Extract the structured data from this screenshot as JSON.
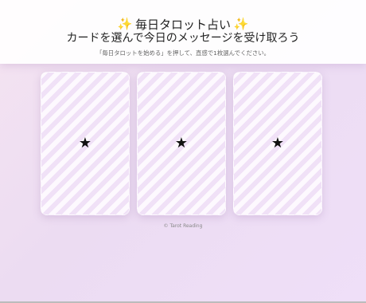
{
  "header": {
    "title": "毎日タロット占い",
    "subtitle": "カードを選んで今日のメッセージを受け取ろう",
    "instruction": "「毎日タロットを始める」を押して、直感で1枚選んでください。",
    "icon_left": "sparkles-icon",
    "icon_right": "sparkles-icon",
    "icon_color": "#e0a722"
  },
  "cards": [
    {
      "symbol": "★"
    },
    {
      "symbol": "★"
    },
    {
      "symbol": "★"
    }
  ],
  "footer": {
    "copyright": "© Tarot Reading"
  }
}
